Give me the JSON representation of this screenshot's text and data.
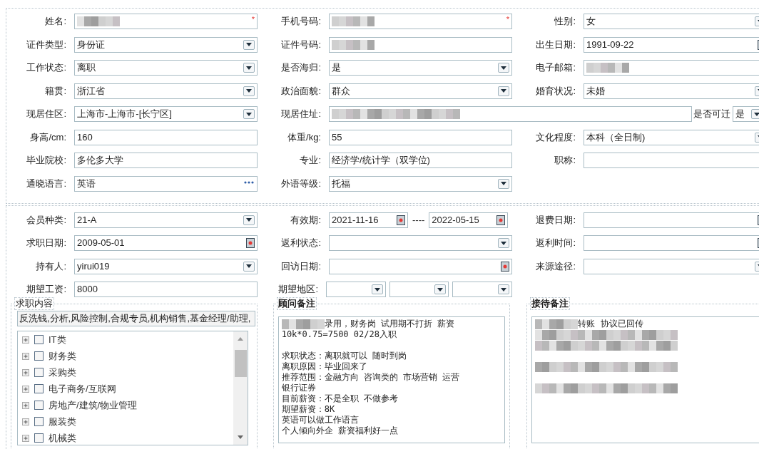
{
  "basic_info": {
    "rows": [
      [
        {
          "label": "姓名:",
          "kind": "text",
          "redacted": true,
          "required_mark": "*"
        },
        {
          "label": "手机号码:",
          "kind": "text",
          "redacted": true,
          "required_mark": "*"
        },
        {
          "label": "性别:",
          "kind": "select",
          "value": "女"
        }
      ],
      [
        {
          "label": "证件类型:",
          "kind": "select",
          "value": "身份证"
        },
        {
          "label": "证件号码:",
          "kind": "text",
          "redacted": true
        },
        {
          "label": "出生日期:",
          "kind": "date",
          "value": "1991-09-22"
        }
      ],
      [
        {
          "label": "工作状态:",
          "kind": "select",
          "value": "离职"
        },
        {
          "label": "是否海归:",
          "kind": "select",
          "value": "是"
        },
        {
          "label": "电子邮箱:",
          "kind": "text",
          "redacted": true
        }
      ],
      [
        {
          "label": "籍贯:",
          "kind": "select",
          "value": "浙江省"
        },
        {
          "label": "政治面貌:",
          "kind": "select",
          "value": "群众"
        },
        {
          "label": "婚育状况:",
          "kind": "select",
          "value": "未婚"
        }
      ],
      [
        {
          "label": "现居住区:",
          "kind": "select",
          "value": "上海市-上海市-[长宁区]"
        },
        {
          "label": "现居住址:",
          "kind": "wide_text",
          "redacted": true
        },
        {
          "label": "是否可迁",
          "kind": "compact_select",
          "value": "是"
        }
      ],
      [
        {
          "label": "身高/cm:",
          "kind": "text",
          "value": "160"
        },
        {
          "label": "体重/kg:",
          "kind": "text",
          "value": "55"
        },
        {
          "label": "文化程度:",
          "kind": "select",
          "value": "本科（全日制)"
        }
      ],
      [
        {
          "label": "毕业院校:",
          "kind": "text",
          "value": "多伦多大学"
        },
        {
          "label": "专业:",
          "kind": "text",
          "value": "经济学/统计学（双学位)"
        },
        {
          "label": "职称:",
          "kind": "text"
        }
      ],
      [
        {
          "label": "通晓语言:",
          "kind": "lookup",
          "value": "英语"
        },
        {
          "label": "外语等级:",
          "kind": "select",
          "value": "托福"
        }
      ]
    ]
  },
  "membership": {
    "rows": [
      [
        {
          "label": "会员种类:",
          "kind": "select",
          "value": "21-A"
        },
        {
          "label": "有效期:",
          "kind": "date_range",
          "values": [
            "2021-11-16",
            "2022-05-15"
          ],
          "separator": "----"
        },
        {
          "label": "退费日期:",
          "kind": "date"
        }
      ],
      [
        {
          "label": "求职日期:",
          "kind": "date",
          "value": "2009-05-01"
        },
        {
          "label": "返利状态:",
          "kind": "select"
        },
        {
          "label": "返利时间:",
          "kind": "date"
        }
      ],
      [
        {
          "label": "持有人:",
          "kind": "select",
          "value": "yirui019"
        },
        {
          "label": "回访日期:",
          "kind": "date"
        },
        {
          "label": "来源途径:",
          "kind": "select"
        }
      ],
      [
        {
          "label": "期望工资:",
          "kind": "text",
          "value": "8000"
        },
        {
          "label": "期望地区:",
          "kind": "region_select"
        }
      ]
    ]
  },
  "job_content": {
    "title": "求职内容",
    "summary": "反洗钱,分析,风险控制,合规专员,机构销售,基金经理/助理,",
    "tree": [
      {
        "label": "IT类",
        "checked": false,
        "expanded": false
      },
      {
        "label": "财务类",
        "checked": false,
        "expanded": false
      },
      {
        "label": "采购类",
        "checked": false,
        "expanded": false
      },
      {
        "label": "电子商务/互联网",
        "checked": false,
        "expanded": false
      },
      {
        "label": "房地产/建筑/物业管理",
        "checked": false,
        "expanded": false
      },
      {
        "label": "服装类",
        "checked": false,
        "expanded": false
      },
      {
        "label": "机械类",
        "checked": false,
        "expanded": false
      }
    ]
  },
  "advisor_notes": {
    "title": "顾问备注",
    "lines": [
      {
        "kind": "text",
        "blurred_prefix": true,
        "text": "录用，财务岗  试用期不打折 薪资"
      },
      {
        "kind": "text",
        "text": "10k*0.75=7500  02/28入职"
      },
      {
        "kind": "blank"
      },
      {
        "kind": "text",
        "text": "求职状态：离职就可以  随时到岗"
      },
      {
        "kind": "text",
        "text": "离职原因：毕业回来了"
      },
      {
        "kind": "text",
        "text": "推荐范围：金融方向 咨询类的 市场营销 运营"
      },
      {
        "kind": "text",
        "text": "银行证券"
      },
      {
        "kind": "text",
        "text": "目前薪资：不是全职 不做参考"
      },
      {
        "kind": "text",
        "text": "期望薪资：8K"
      },
      {
        "kind": "text",
        "text": "英语可以做工作语言"
      },
      {
        "kind": "text",
        "text": "个人倾向外企 薪资福利好一点"
      }
    ]
  },
  "reception_notes": {
    "title": "接待备注",
    "lines": [
      {
        "kind": "text",
        "blurred_prefix": true,
        "text": "转账 协议已回传"
      },
      {
        "kind": "blurred"
      },
      {
        "kind": "blurred"
      },
      {
        "kind": "blank"
      },
      {
        "kind": "blurred"
      },
      {
        "kind": "blank"
      },
      {
        "kind": "blurred"
      }
    ]
  }
}
